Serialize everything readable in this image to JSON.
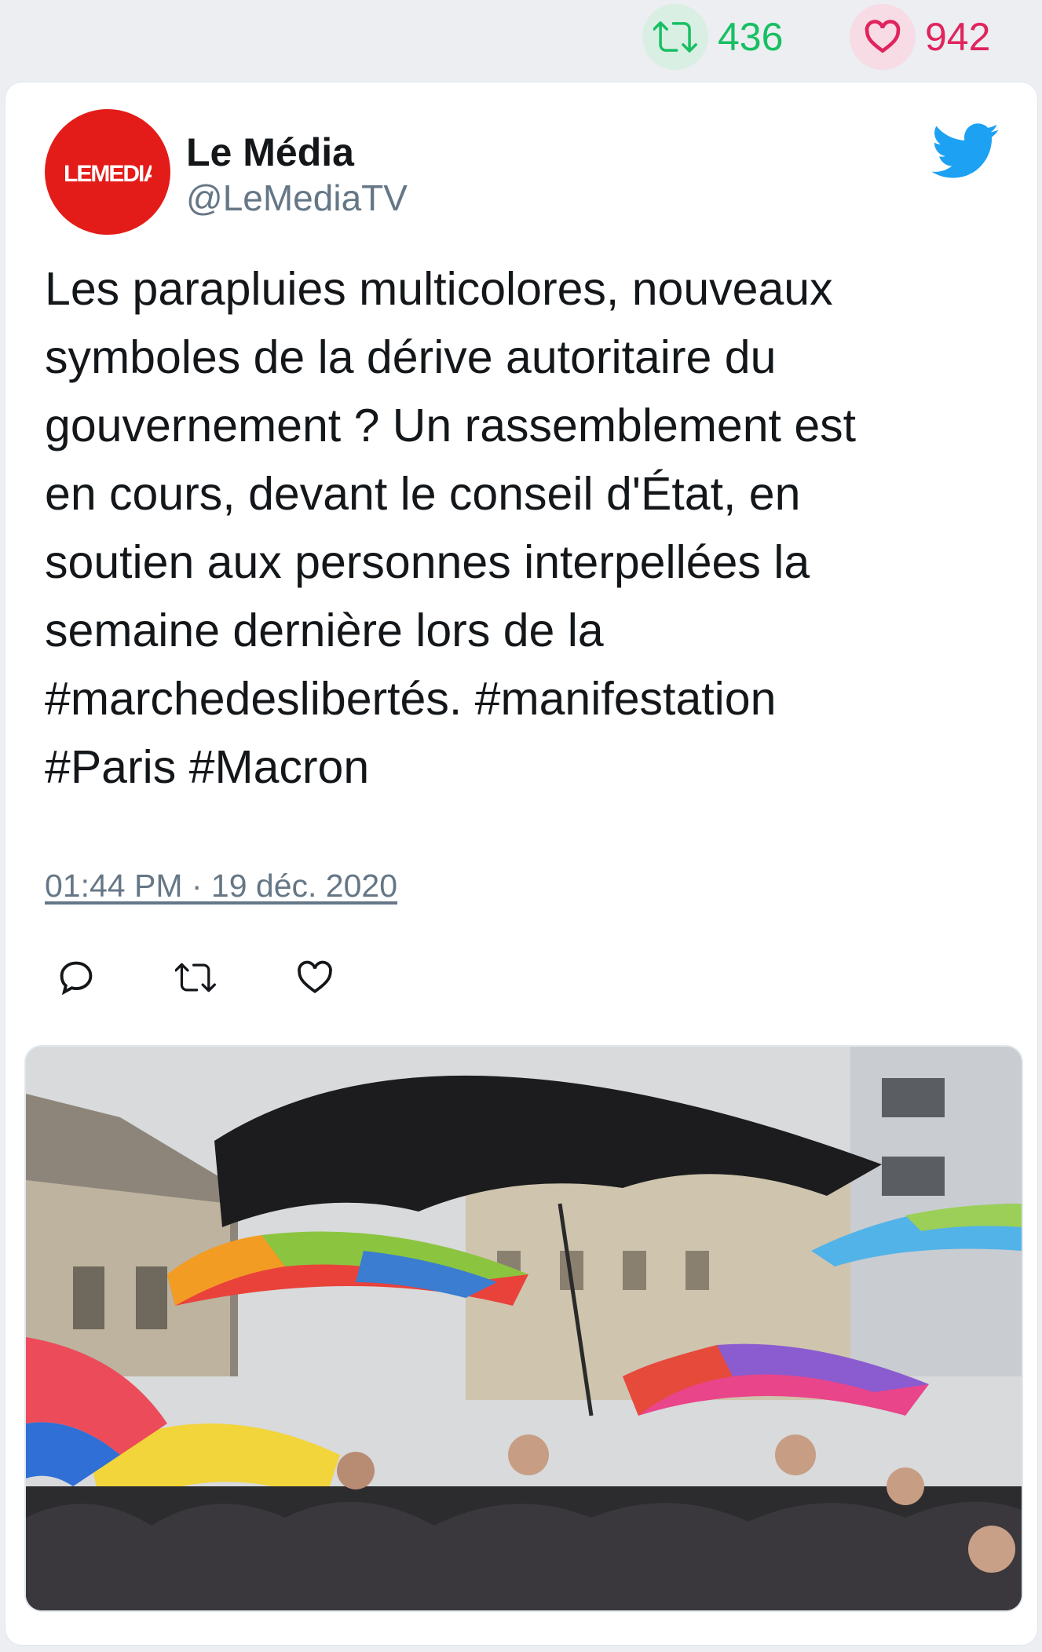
{
  "stats": {
    "retweets": "436",
    "likes": "942",
    "retweet_icon": "retweet-icon",
    "like_icon": "heart-icon"
  },
  "tweet": {
    "author_name": "Le Média",
    "author_handle": "@LeMediaTV",
    "avatar_text": "LEMEDIA",
    "text": "Les parapluies multicolores, nouveaux\nsymboles de la dérive autoritaire du\ngouvernement ? Un rassemblement est\nen cours, devant le conseil d'État, en\nsoutien aux personnes interpellées la\nsemaine dernière lors de la\n#marchedeslibertés. #manifestation\n#Paris #Macron",
    "timestamp": "01:44 PM · 19 déc. 2020",
    "actions": [
      "reply-icon",
      "retweet-icon",
      "like-icon"
    ]
  },
  "colors": {
    "twitter_blue": "#1da1f2",
    "retweet_green": "#17bf63",
    "like_pink": "#e0245e",
    "avatar_red": "#e31c19"
  }
}
